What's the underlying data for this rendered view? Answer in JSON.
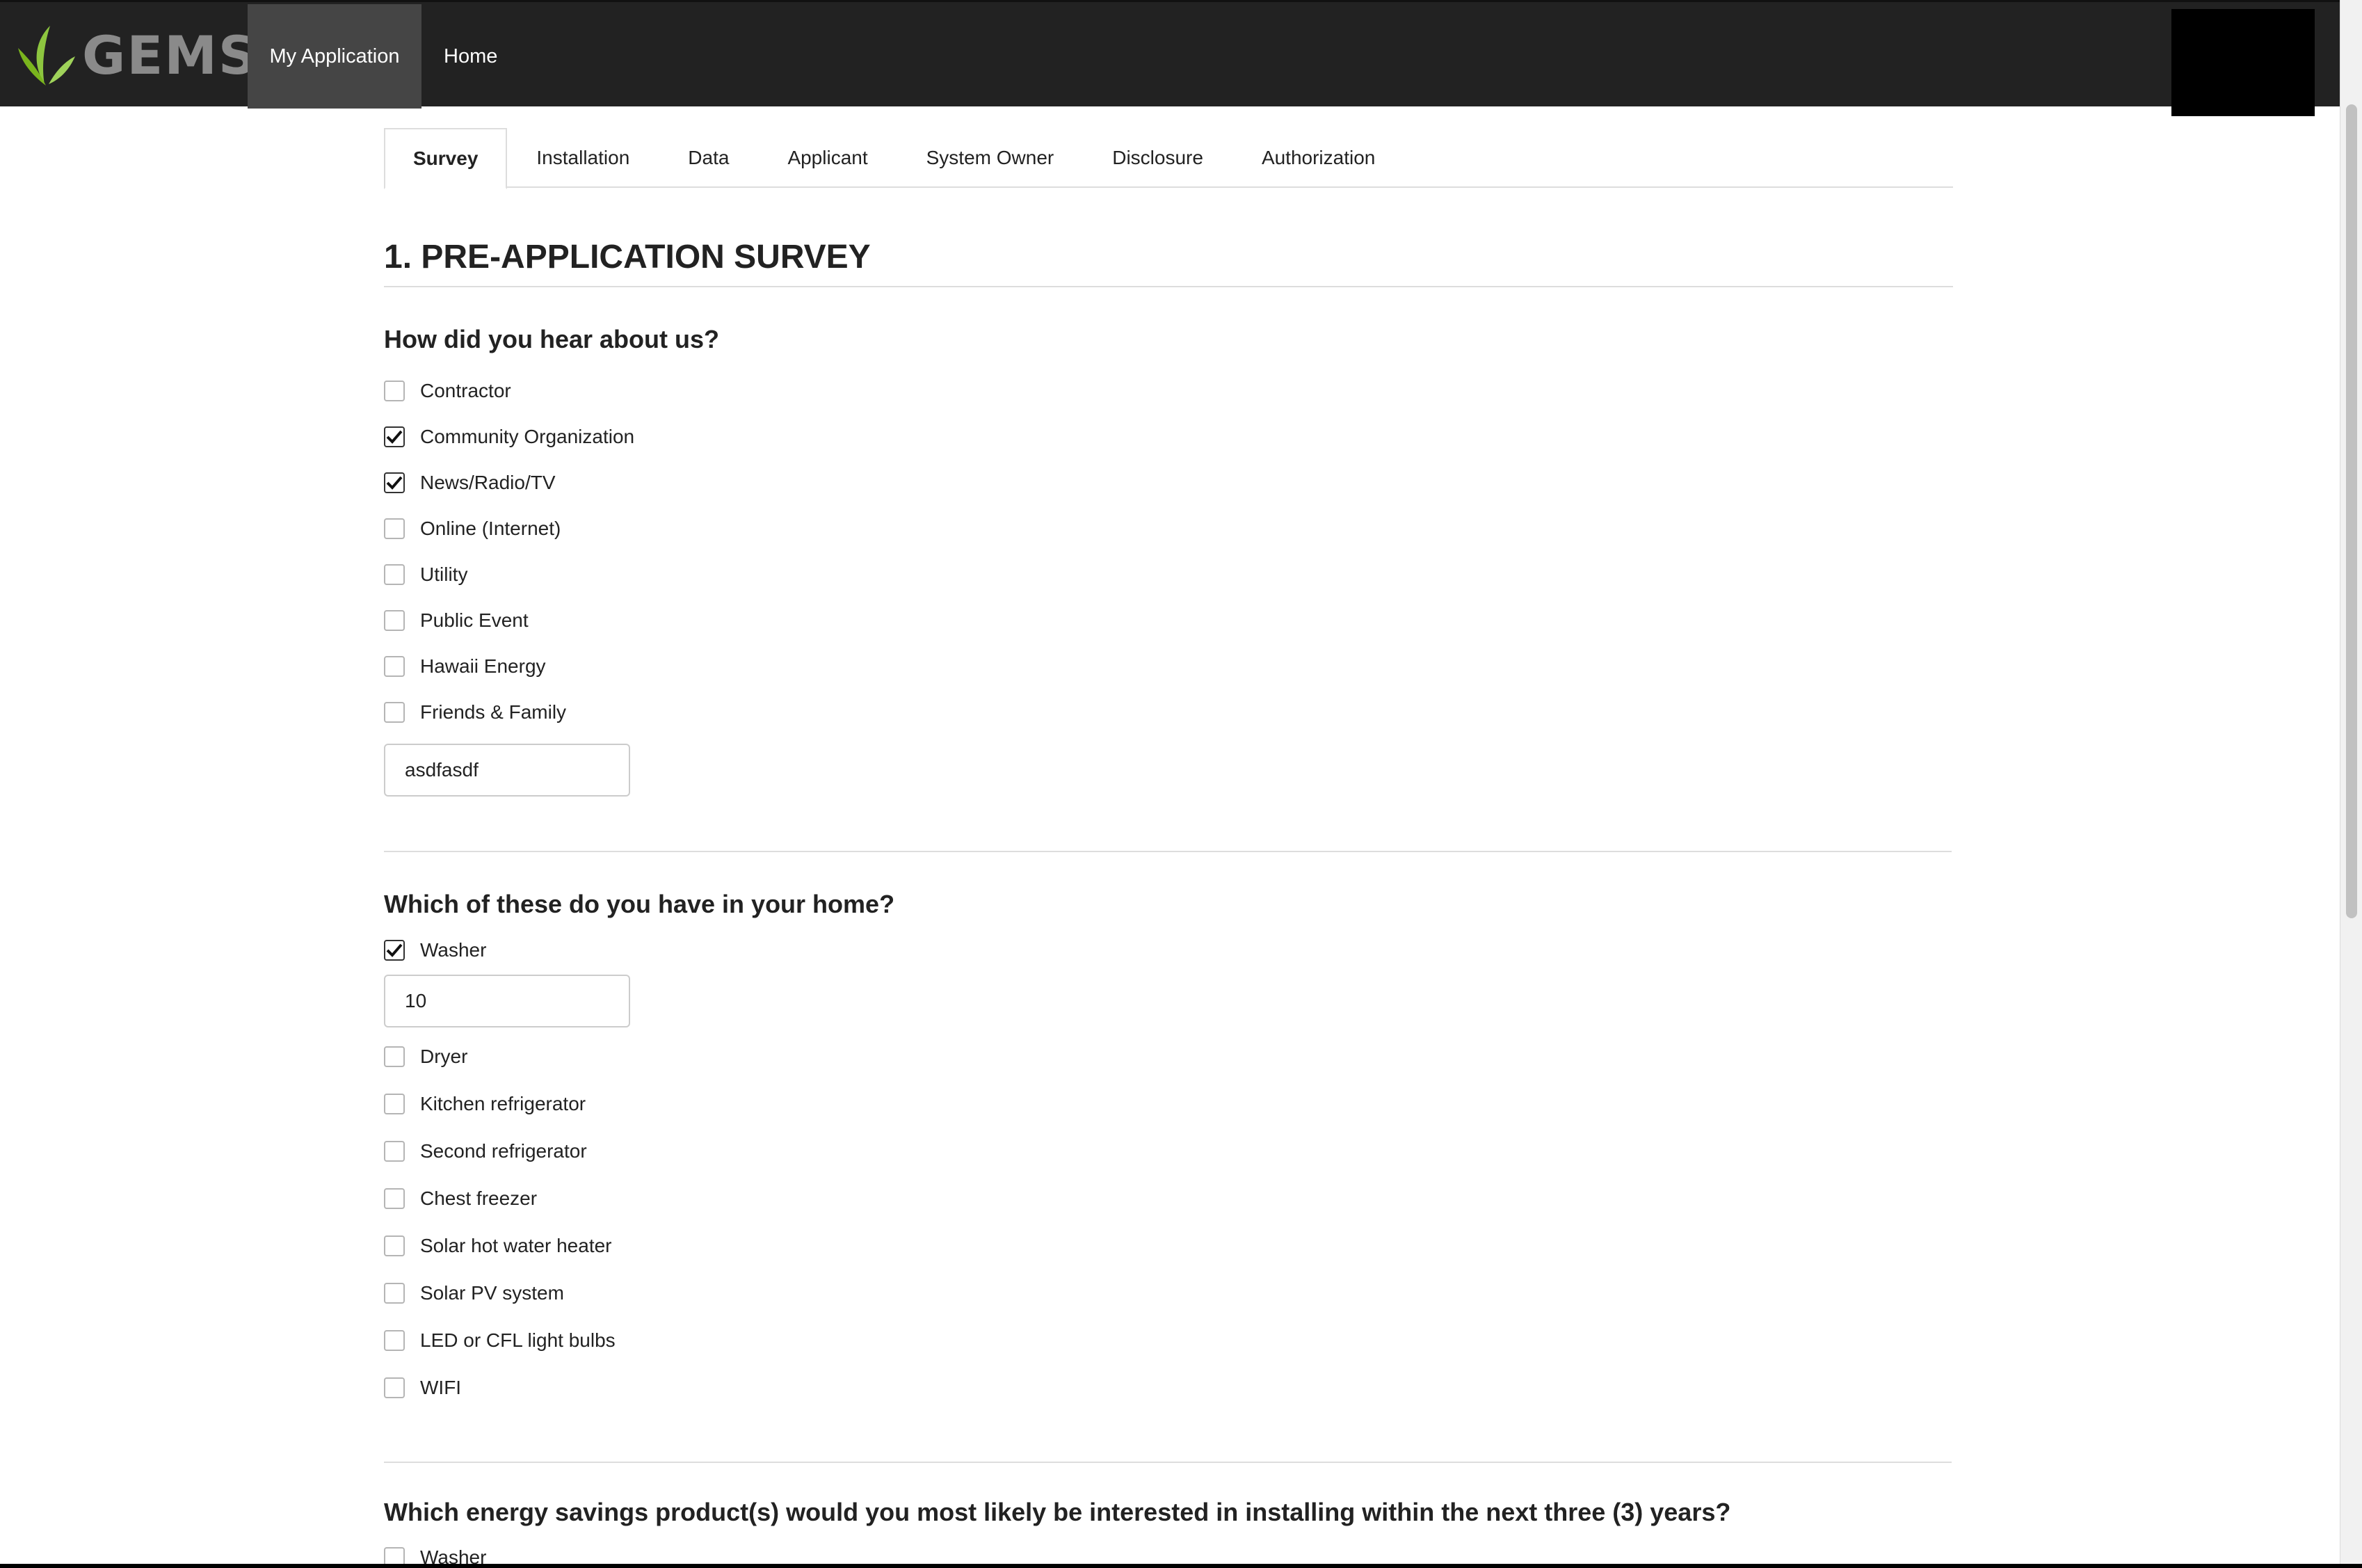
{
  "navbar": {
    "brand_text": "GEMS",
    "logo_color": "#8dc63f",
    "items": [
      {
        "label": "My Application",
        "active": true
      },
      {
        "label": "Home",
        "active": false
      }
    ]
  },
  "tabs": [
    {
      "label": "Survey",
      "active": true
    },
    {
      "label": "Installation",
      "active": false
    },
    {
      "label": "Data",
      "active": false
    },
    {
      "label": "Applicant",
      "active": false
    },
    {
      "label": "System Owner",
      "active": false
    },
    {
      "label": "Disclosure",
      "active": false
    },
    {
      "label": "Authorization",
      "active": false
    }
  ],
  "section_title": "1. PRE-APPLICATION SURVEY",
  "q1": {
    "question": "How did you hear about us?",
    "options": [
      {
        "label": "Contractor",
        "checked": false
      },
      {
        "label": "Community Organization",
        "checked": true
      },
      {
        "label": "News/Radio/TV",
        "checked": true
      },
      {
        "label": "Online (Internet)",
        "checked": false
      },
      {
        "label": "Utility",
        "checked": false
      },
      {
        "label": "Public Event",
        "checked": false
      },
      {
        "label": "Hawaii Energy",
        "checked": false
      },
      {
        "label": "Friends & Family",
        "checked": false
      }
    ],
    "other_value": "asdfasdf"
  },
  "q2": {
    "question": "Which of these do you have in your home?",
    "washer": {
      "label": "Washer",
      "checked": true,
      "value": "10"
    },
    "options": [
      {
        "label": "Dryer",
        "checked": false
      },
      {
        "label": "Kitchen refrigerator",
        "checked": false
      },
      {
        "label": "Second refrigerator",
        "checked": false
      },
      {
        "label": "Chest freezer",
        "checked": false
      },
      {
        "label": "Solar hot water heater",
        "checked": false
      },
      {
        "label": "Solar PV system",
        "checked": false
      },
      {
        "label": "LED or CFL light bulbs",
        "checked": false
      },
      {
        "label": "WIFI",
        "checked": false
      }
    ]
  },
  "q3": {
    "question": "Which energy savings product(s) would you most likely be interested in installing within the next three (3) years?",
    "first_option": {
      "label": "Washer",
      "checked": false
    }
  }
}
